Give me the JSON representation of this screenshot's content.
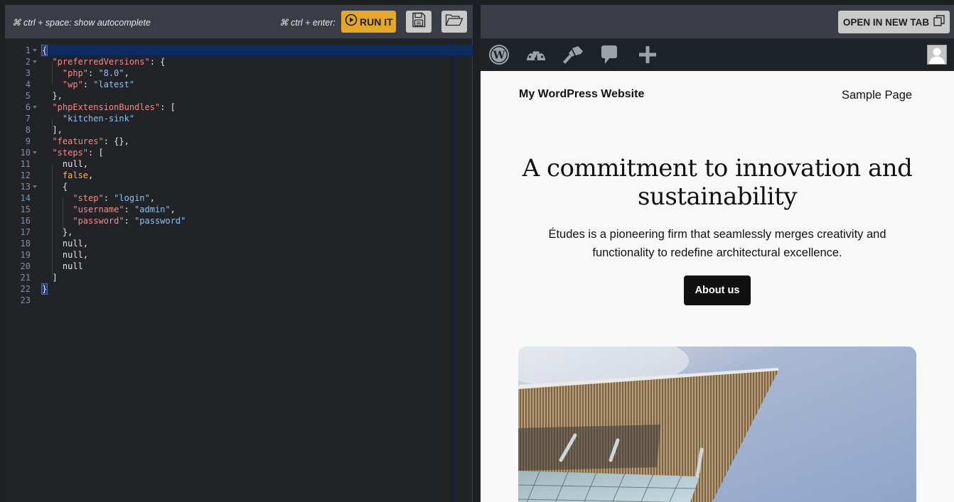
{
  "editor_toolbar": {
    "autocomplete_hint": "⌘ ctrl + space: show autocomplete",
    "run_hint": "⌘ ctrl + enter:",
    "run_label": "RUN IT",
    "run_icon": "play-circle-icon",
    "save_icon": "floppy-disk-icon",
    "open_icon": "folder-open-icon",
    "run_color": "#e4a72a"
  },
  "editor": {
    "active_line": 1,
    "lines": [
      {
        "n": "1",
        "fold": true
      },
      {
        "n": "2",
        "fold": true
      },
      {
        "n": "3",
        "fold": false
      },
      {
        "n": "4",
        "fold": false
      },
      {
        "n": "5",
        "fold": false
      },
      {
        "n": "6",
        "fold": true
      },
      {
        "n": "7",
        "fold": false
      },
      {
        "n": "8",
        "fold": false
      },
      {
        "n": "9",
        "fold": false
      },
      {
        "n": "10",
        "fold": true
      },
      {
        "n": "11",
        "fold": false
      },
      {
        "n": "12",
        "fold": false
      },
      {
        "n": "13",
        "fold": true
      },
      {
        "n": "14",
        "fold": false
      },
      {
        "n": "15",
        "fold": false
      },
      {
        "n": "16",
        "fold": false
      },
      {
        "n": "17",
        "fold": false
      },
      {
        "n": "18",
        "fold": false
      },
      {
        "n": "19",
        "fold": false
      },
      {
        "n": "20",
        "fold": false
      },
      {
        "n": "21",
        "fold": false
      },
      {
        "n": "22",
        "fold": false
      },
      {
        "n": "23",
        "fold": false
      }
    ],
    "code": {
      "l1_open": "{",
      "k_preferredVersions": "\"preferredVersions\"",
      "k_php": "\"php\"",
      "v_php": "\"8.0\"",
      "k_wp": "\"wp\"",
      "v_wp": "\"latest\"",
      "k_phpExtensionBundles": "\"phpExtensionBundles\"",
      "v_bundle": "\"kitchen-sink\"",
      "k_features": "\"features\"",
      "k_steps": "\"steps\"",
      "v_null": "null",
      "v_false": "false",
      "k_step": "\"step\"",
      "v_step": "\"login\"",
      "k_username": "\"username\"",
      "v_username": "\"admin\"",
      "k_password": "\"password\"",
      "v_password": "\"password\"",
      "l22_close": "}"
    }
  },
  "preview_toolbar": {
    "open_new_tab_label": "OPEN IN NEW TAB",
    "open_new_tab_icon": "copy-window-icon"
  },
  "admin_bar": {
    "icons": [
      "wordpress-logo-icon",
      "dashboard-gauge-icon",
      "customize-brush-icon",
      "comments-icon",
      "new-content-plus-icon"
    ],
    "avatar": "user-avatar"
  },
  "site": {
    "title": "My WordPress Website",
    "nav": [
      "Sample Page"
    ],
    "hero_heading": "A commitment to innovation and sustainability",
    "hero_text": "Études is a pioneering firm that seamlessly merges creativity and functionality to redefine architectural excellence.",
    "cta_label": "About us",
    "hero_image": "building-roof-against-sky-photo"
  }
}
